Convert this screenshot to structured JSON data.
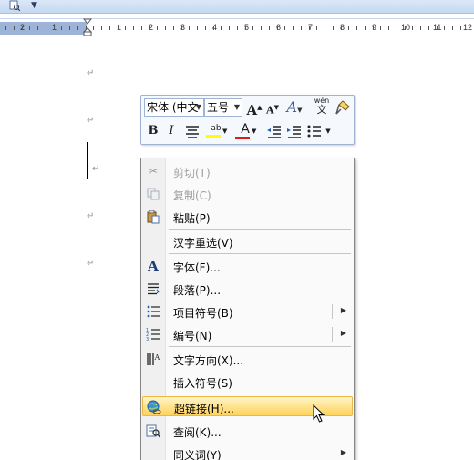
{
  "document": {
    "paragraph_mark": "↵"
  },
  "mini_toolbar": {
    "font_name": "宋体 (中文",
    "font_size": "五号",
    "grow_font": "A",
    "shrink_font": "A",
    "styles": "A",
    "phonetic_guide": "wén",
    "phonetic_char": "文",
    "bold": "B",
    "italic": "I",
    "highlight_label": "ab",
    "font_color_label": "A",
    "highlight_color": "#ffff00",
    "font_color": "#e01b1b"
  },
  "ruler": {
    "numbers": [
      "2",
      "1",
      "1",
      "2",
      "3",
      "4",
      "5",
      "6",
      "7",
      "8",
      "9",
      "10",
      "11",
      "12"
    ]
  },
  "context_menu": {
    "items": [
      {
        "label": "剪切(T)",
        "icon": "scissors-icon",
        "disabled": true
      },
      {
        "label": "复制(C)",
        "icon": "copy-icon",
        "disabled": true
      },
      {
        "label": "粘贴(P)",
        "icon": "paste-icon",
        "disabled": false
      },
      {
        "label": "汉字重选(V)",
        "icon": "",
        "disabled": false
      },
      {
        "label": "字体(F)...",
        "icon": "font-icon",
        "disabled": false
      },
      {
        "label": "段落(P)...",
        "icon": "paragraph-icon",
        "disabled": false
      },
      {
        "label": "项目符号(B)",
        "icon": "bullets-icon",
        "disabled": false,
        "submenu": true
      },
      {
        "label": "编号(N)",
        "icon": "numbering-icon",
        "disabled": false,
        "submenu": true
      },
      {
        "label": "文字方向(X)...",
        "icon": "text-direction-icon",
        "disabled": false
      },
      {
        "label": "插入符号(S)",
        "icon": "",
        "disabled": false
      },
      {
        "label": "超链接(H)...",
        "icon": "hyperlink-icon",
        "disabled": false,
        "hovered": true
      },
      {
        "label": "查阅(K)...",
        "icon": "research-icon",
        "disabled": false
      },
      {
        "label": "同义词(Y)",
        "icon": "",
        "disabled": false,
        "submenu": true
      }
    ]
  }
}
